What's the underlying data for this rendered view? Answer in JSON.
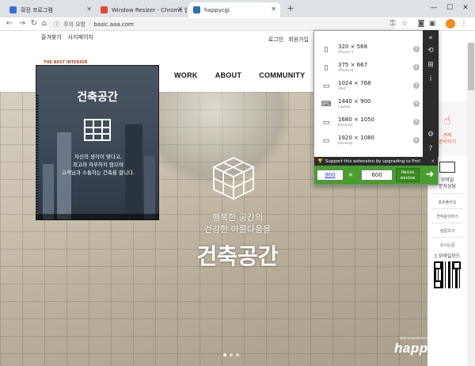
{
  "browser": {
    "tabs": [
      {
        "title": "확장 프로그램",
        "active": false
      },
      {
        "title": "Window Resizer - Chrome 웹 스",
        "active": false
      },
      {
        "title": "happycgi",
        "active": true
      }
    ],
    "new_tab": "+",
    "window_controls": {
      "minimize": "—",
      "maximize": "☐",
      "close": "✕"
    },
    "address": {
      "security": "주의 요함",
      "url": "basic.aaa.com"
    },
    "bookmarks": [
      "즐겨찾기",
      "사지페이지"
    ]
  },
  "site": {
    "top_links": [
      "로그인",
      "회원가입"
    ],
    "brand_tag": "THE BEST INTERIOR",
    "nav": [
      "WORK",
      "ABOUT",
      "COMMUNITY"
    ],
    "card": {
      "title": "건축공간",
      "lines": [
        "자신의 생각이 맞다고,",
        "최고라 자부하지 않으며",
        "고객님과 소통하는 건축을 합니다."
      ]
    },
    "hero": {
      "subtitle_1": "행복한 공간의",
      "subtitle_2": "건강한 아름다움을",
      "title": "건축공간"
    },
    "slides": 3,
    "logo": "happycgi",
    "logo_sub": "web programming group"
  },
  "quick_menu": {
    "top_label_1": "견적",
    "top_label_2": "문의하기",
    "consult_1": "모바일",
    "consult_2": "문자상담",
    "links": [
      "포트폴리오",
      "견적문의하기",
      "설문조사",
      "오시는길"
    ],
    "mobile_label": "모바일모드"
  },
  "resizer": {
    "presets": [
      {
        "res": "320 × 568",
        "device": "iPhone 5",
        "num": "1",
        "icon": "phone"
      },
      {
        "res": "375 × 667",
        "device": "iPhone 6",
        "num": "2",
        "icon": "phone"
      },
      {
        "res": "1024 × 768",
        "device": "iPad",
        "num": "3",
        "icon": "tablet"
      },
      {
        "res": "1440 × 900",
        "device": "Laptop",
        "num": "4",
        "icon": "laptop"
      },
      {
        "res": "1680 × 1050",
        "device": "Desktop",
        "num": "5",
        "icon": "desktop"
      },
      {
        "res": "1920 × 1080",
        "device": "Desktop",
        "num": "6",
        "icon": "desktop"
      }
    ],
    "promo": "Support this extension by upgrading to Pro!",
    "width_value": "900",
    "times": "×",
    "height_value": "600",
    "resize_label_1": "Resize",
    "resize_label_2": "window",
    "go_label": "➜"
  },
  "colors": {
    "resize_green": "#4a9d2f",
    "popup_dark": "#2b2b2b",
    "tab_bar": "#dee1e6"
  }
}
